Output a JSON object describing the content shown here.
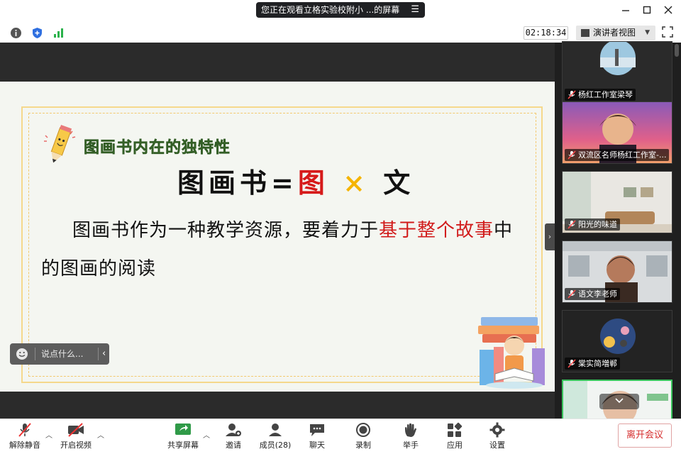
{
  "title_bar": {
    "sharing_notice": "您正在观看立格实验校附小   ...的屏幕",
    "menu_glyph": "☰"
  },
  "info_bar": {
    "timer": "02:18:34",
    "view_mode": "演讲者视图"
  },
  "slide": {
    "heading": "图画书内在的独特性",
    "formula": {
      "a": "图画书",
      "eq": "=",
      "b": "图",
      "x": "×",
      "c": "文"
    },
    "body_before": "图画书作为一种教学资源，要着力于",
    "body_red1": "基于整个故",
    "body_red2": "事",
    "body_after": "中的图画的阅读"
  },
  "chat": {
    "placeholder": "说点什么..."
  },
  "participants": [
    {
      "name": "杨红工作室梁琴"
    },
    {
      "name": "双流区名师杨红工作室-..."
    },
    {
      "name": "阳光的味道"
    },
    {
      "name": "语文李老师"
    },
    {
      "name": "棠实简増郸"
    }
  ],
  "toolbar": {
    "unmute": "解除静音",
    "start_video": "开启视频",
    "share_screen": "共享屏幕",
    "invite": "邀请",
    "members": "成员(28)",
    "chat": "聊天",
    "record": "录制",
    "raise_hand": "举手",
    "apps": "应用",
    "settings": "设置",
    "leave": "离开会议"
  },
  "colors": {
    "accent_red": "#d61a1a",
    "accent_yellow": "#f5b400",
    "heading_green": "#4c7a37",
    "leave_red": "#d52b2b"
  }
}
